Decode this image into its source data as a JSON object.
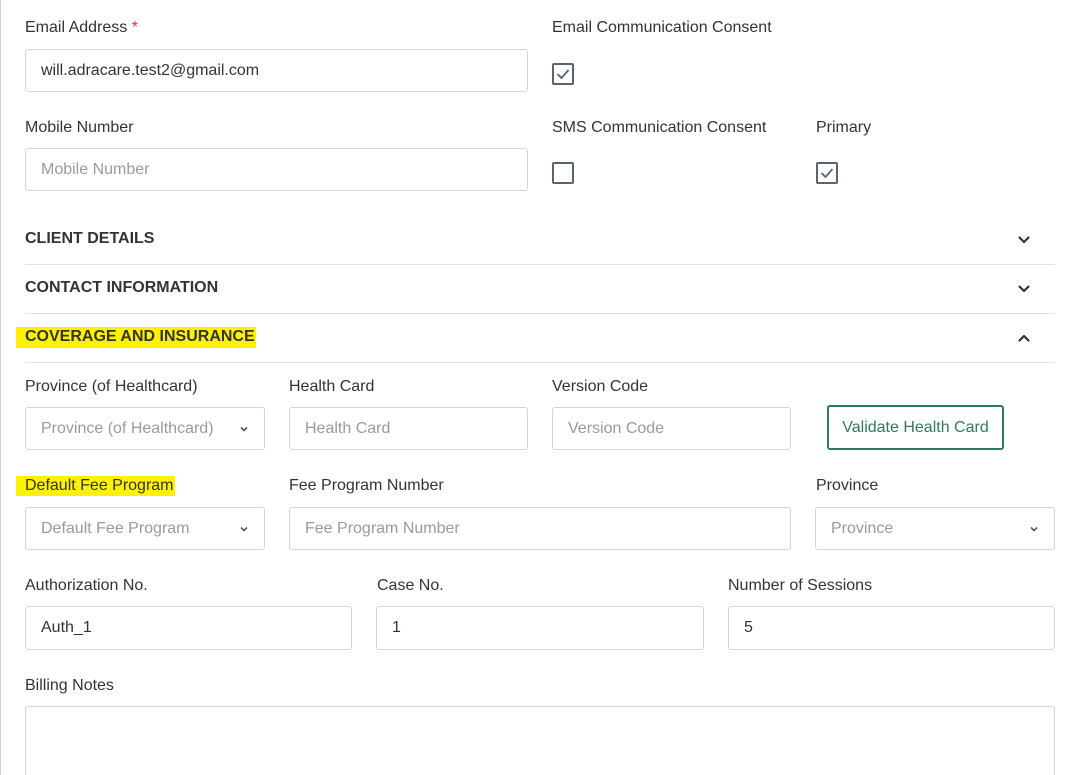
{
  "email_section": {
    "email": {
      "label": "Email Address",
      "required_mark": "*",
      "value": "will.adracare.test2@gmail.com"
    },
    "email_consent": {
      "label": "Email Communication Consent",
      "checked": true
    },
    "mobile": {
      "label": "Mobile Number",
      "value": "",
      "placeholder": "Mobile Number"
    },
    "sms_consent": {
      "label": "SMS Communication Consent",
      "checked": false
    },
    "primary": {
      "label": "Primary",
      "checked": true
    }
  },
  "sections": {
    "client_details": {
      "title": "CLIENT DETAILS",
      "expanded": false,
      "icon": "chevron-down-icon"
    },
    "contact_information": {
      "title": "CONTACT INFORMATION",
      "expanded": false,
      "icon": "chevron-down-icon"
    },
    "coverage": {
      "title": "COVERAGE AND INSURANCE",
      "expanded": true,
      "icon": "chevron-up-icon"
    }
  },
  "coverage": {
    "province_healthcard": {
      "label": "Province (of Healthcard)",
      "placeholder": "Province (of Healthcard)"
    },
    "health_card": {
      "label": "Health Card",
      "placeholder": "Health Card",
      "value": ""
    },
    "version_code": {
      "label": "Version Code",
      "placeholder": "Version Code",
      "value": ""
    },
    "validate_button": "Validate Health Card",
    "default_fee_program": {
      "label": "Default Fee Program",
      "placeholder": "Default Fee Program"
    },
    "fee_program_number": {
      "label": "Fee Program Number",
      "placeholder": "Fee Program Number",
      "value": ""
    },
    "province": {
      "label": "Province",
      "placeholder": "Province"
    },
    "authorization_no": {
      "label": "Authorization No.",
      "value": "Auth_1"
    },
    "case_no": {
      "label": "Case No.",
      "value": "1"
    },
    "number_of_sessions": {
      "label": "Number of Sessions",
      "value": "5"
    },
    "billing_notes": {
      "label": "Billing Notes",
      "value": ""
    }
  },
  "colors": {
    "highlight": "#fff200",
    "accent_green": "#2f7a5c",
    "required_red": "#d9342b",
    "checkbox_border": "#5a6470"
  }
}
